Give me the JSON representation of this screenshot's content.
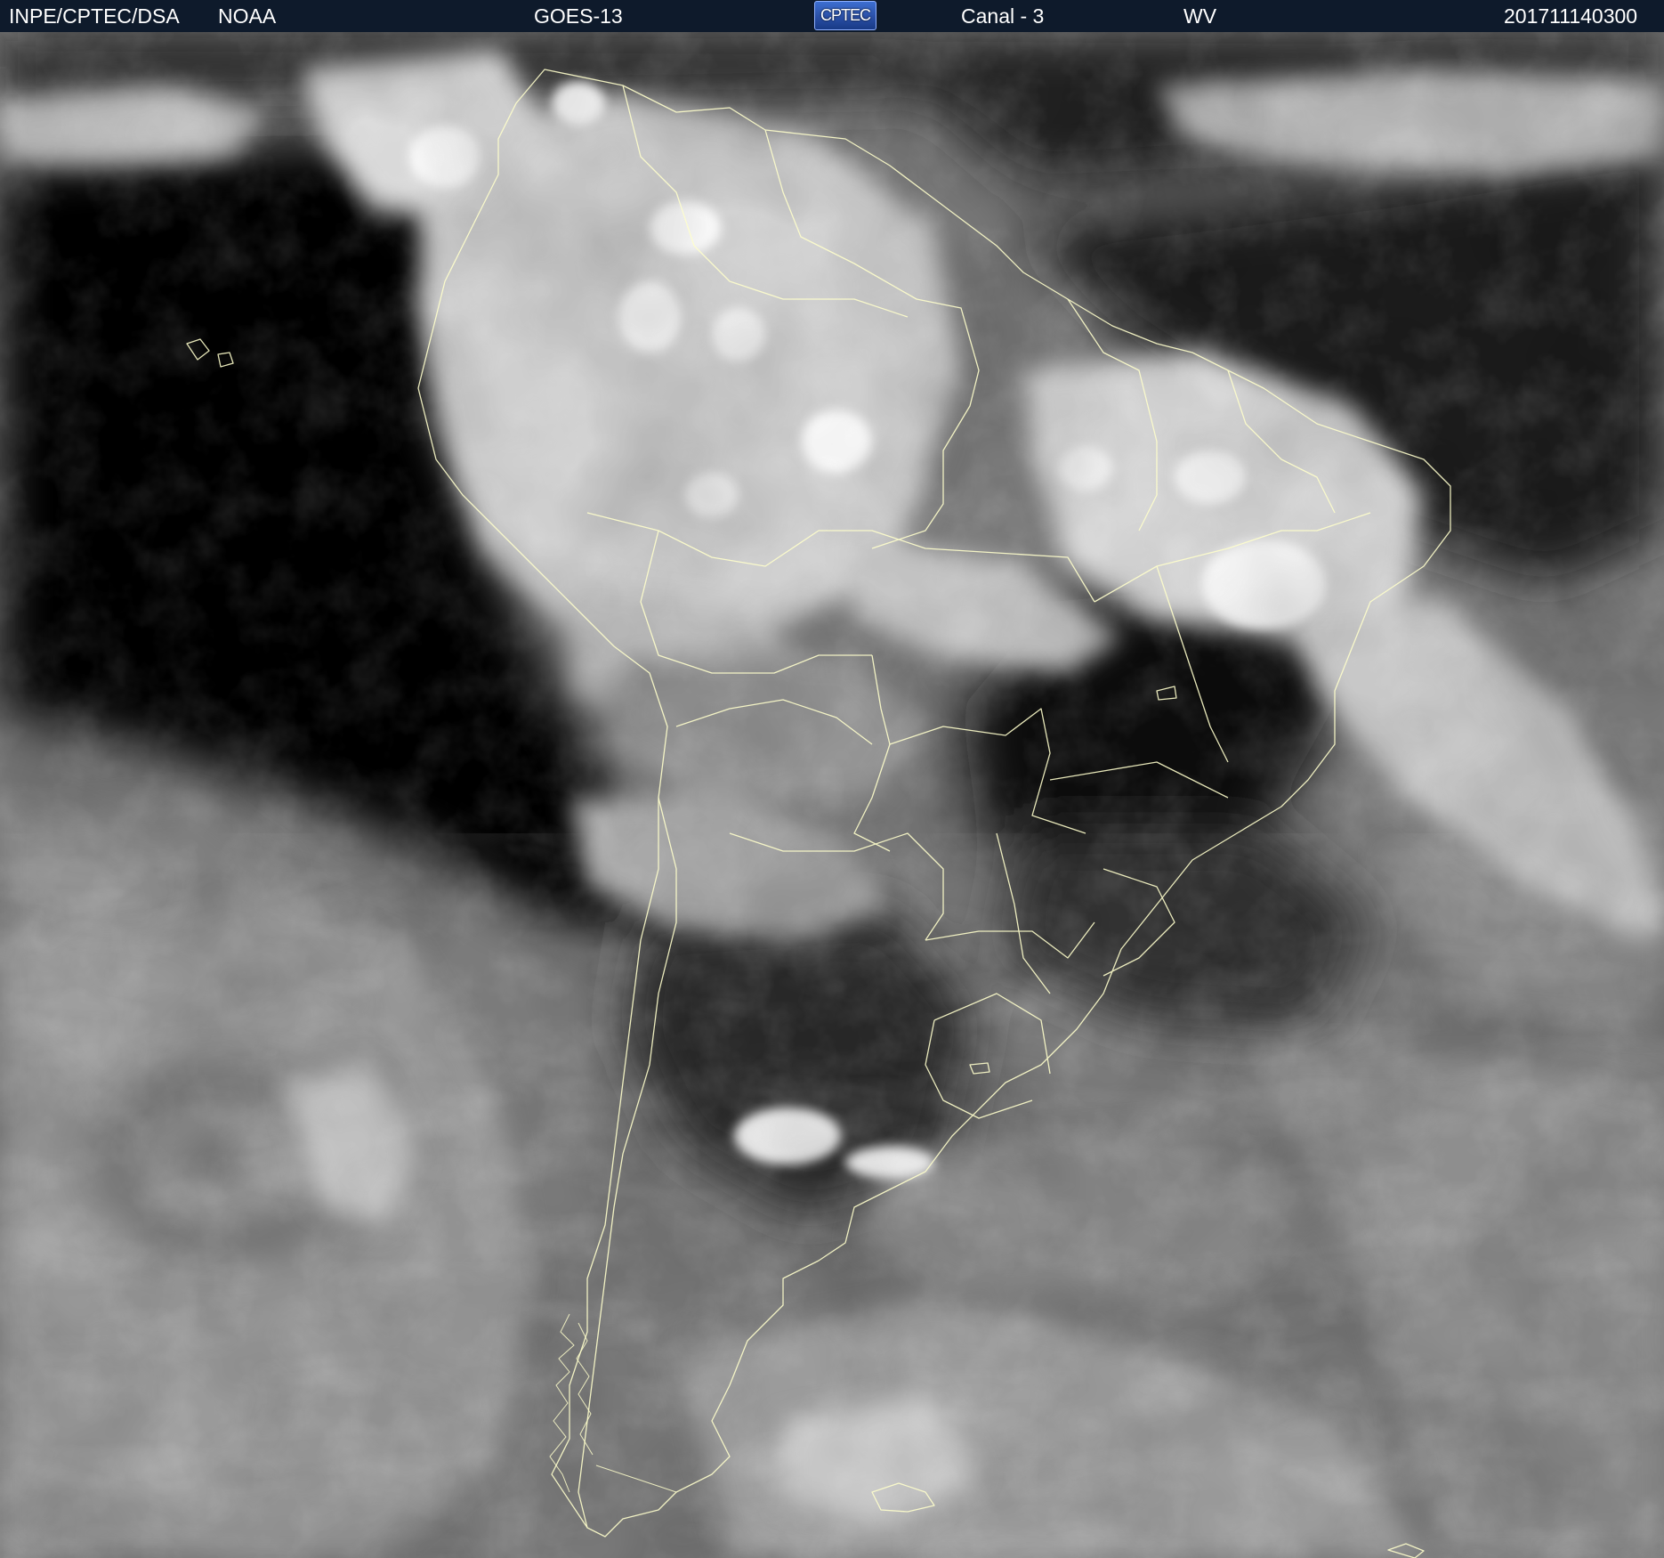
{
  "header": {
    "agency": "INPE/CPTEC/DSA",
    "source": "NOAA",
    "satellite": "GOES-13",
    "logo_text": "CPTEC",
    "channel": "Canal - 3",
    "band": "WV",
    "timestamp": "201711140300"
  },
  "image": {
    "subject": "water-vapor-satellite-image-south-america",
    "overlay_line_color": "#ffffcc",
    "palette": "grayscale"
  }
}
